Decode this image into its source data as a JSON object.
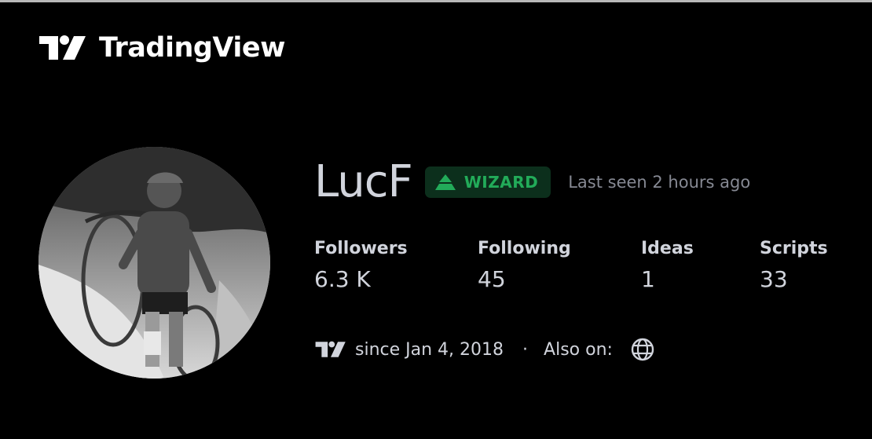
{
  "header": {
    "brand_name": "TradingView",
    "logo_icon": "tradingview-logo-icon"
  },
  "profile": {
    "avatar_icon": "avatar-photo-cyclist",
    "username": "LucF",
    "badge": {
      "icon": "wizard-mountain-icon",
      "label": "WIZARD",
      "text_color": "#22ab59",
      "background_color": "#0c2f1c"
    },
    "last_seen": "Last seen 2 hours ago",
    "stats": [
      {
        "label": "Followers",
        "value": "6.3 K"
      },
      {
        "label": "Following",
        "value": "45"
      },
      {
        "label": "Ideas",
        "value": "1"
      },
      {
        "label": "Scripts",
        "value": "33"
      }
    ],
    "member_since": "since Jan 4, 2018",
    "separator": "·",
    "also_on_label": "Also on:",
    "website_icon": "globe-icon"
  },
  "colors": {
    "background": "#000000",
    "text_primary": "#d1d4dc",
    "text_secondary": "#868993"
  }
}
